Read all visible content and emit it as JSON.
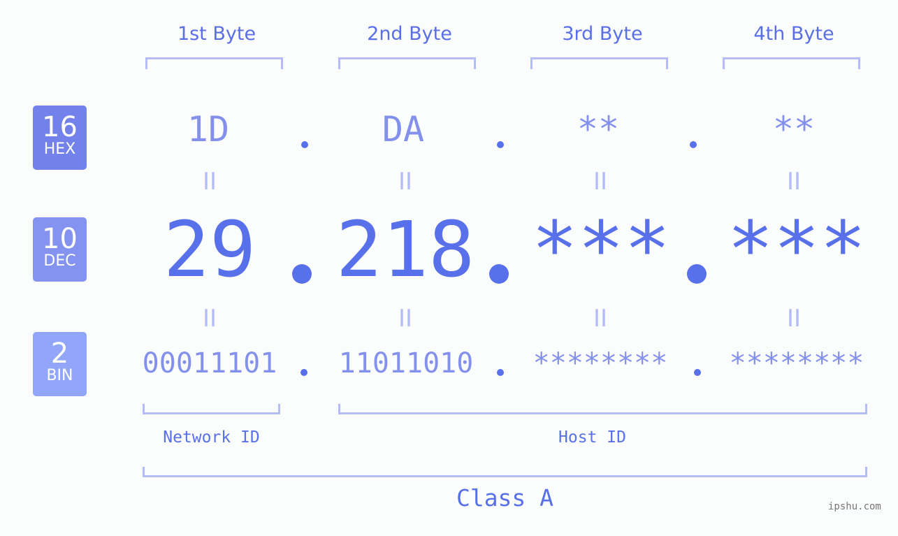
{
  "headers": [
    "1st Byte",
    "2nd Byte",
    "3rd Byte",
    "4th Byte"
  ],
  "badges": [
    {
      "num": "16",
      "label": "HEX",
      "color": "#7382ea"
    },
    {
      "num": "10",
      "label": "DEC",
      "color": "#8492f0"
    },
    {
      "num": "2",
      "label": "BIN",
      "color": "#91a6f8"
    }
  ],
  "hex": [
    "1D",
    "DA",
    "**",
    "**"
  ],
  "dec": [
    "29",
    "218",
    "***",
    "***"
  ],
  "bin": [
    "00011101",
    "11011010",
    "********",
    "********"
  ],
  "equals_sign": "II",
  "segments": {
    "network": "Network ID",
    "host": "Host ID",
    "class": "Class A"
  },
  "footer": "ipshu.com",
  "colors": {
    "accent": "#5870ea",
    "light": "#8491ec",
    "bracket": "#b3bcf6"
  }
}
